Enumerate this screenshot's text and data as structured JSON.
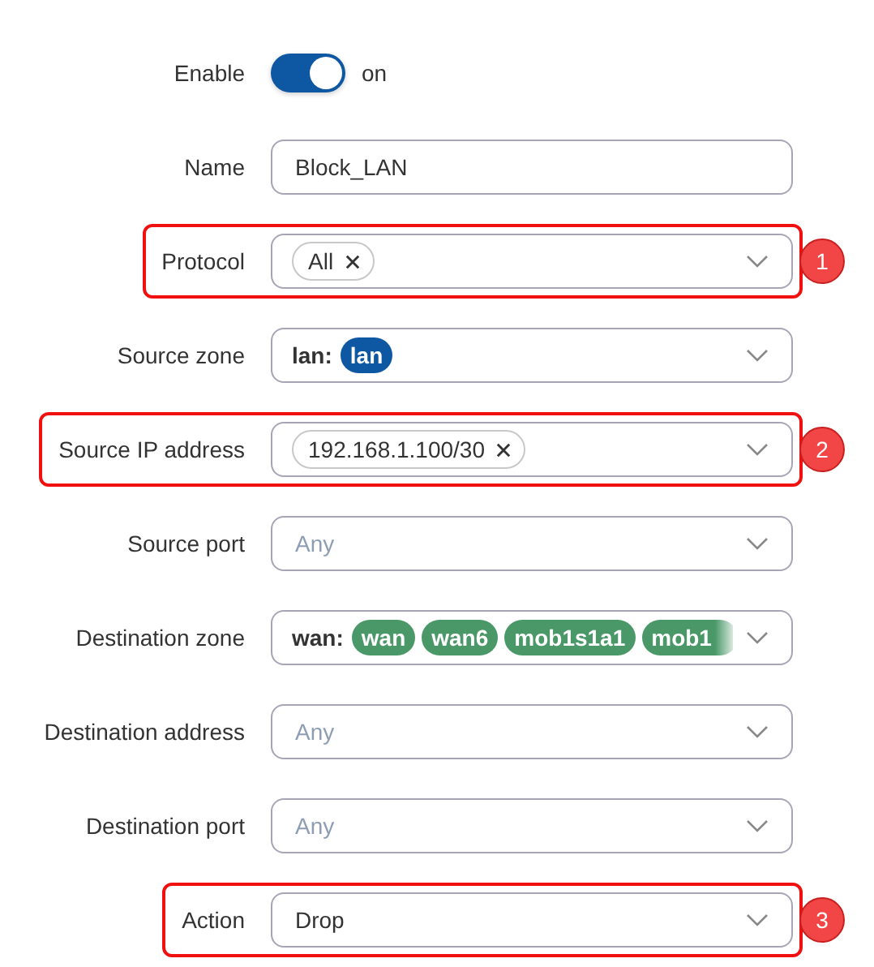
{
  "fields": [
    {
      "label": "Enable",
      "kind": "toggle",
      "on": true,
      "state_text": "on"
    },
    {
      "label": "Name",
      "kind": "text",
      "value": "Block_LAN"
    },
    {
      "label": "Protocol",
      "kind": "select",
      "chips": [
        {
          "kind": "tag",
          "text": "All",
          "removable": true
        }
      ],
      "callout": "1"
    },
    {
      "label": "Source zone",
      "kind": "select",
      "prefix": "lan:",
      "chips": [
        {
          "kind": "zone",
          "text": "lan",
          "color": "#0e57a2",
          "faded": false
        }
      ]
    },
    {
      "label": "Source IP address",
      "kind": "select",
      "chips": [
        {
          "kind": "tag",
          "text": "192.168.1.100/30",
          "removable": true
        }
      ],
      "callout": "2"
    },
    {
      "label": "Source port",
      "kind": "select",
      "placeholder": "Any"
    },
    {
      "label": "Destination zone",
      "kind": "select",
      "prefix": "wan:",
      "chips": [
        {
          "kind": "zone",
          "text": "wan",
          "color": "#4a9868",
          "faded": false
        },
        {
          "kind": "zone",
          "text": "wan6",
          "color": "#4a9868",
          "faded": false
        },
        {
          "kind": "zone",
          "text": "mob1s1a1",
          "color": "#4a9868",
          "faded": false
        },
        {
          "kind": "zone",
          "text": "mob1",
          "color": "#4a9868",
          "faded": true
        }
      ]
    },
    {
      "label": "Destination address",
      "kind": "select",
      "placeholder": "Any"
    },
    {
      "label": "Destination port",
      "kind": "select",
      "placeholder": "Any"
    },
    {
      "label": "Action",
      "kind": "select",
      "value": "Drop",
      "callout": "3"
    }
  ]
}
